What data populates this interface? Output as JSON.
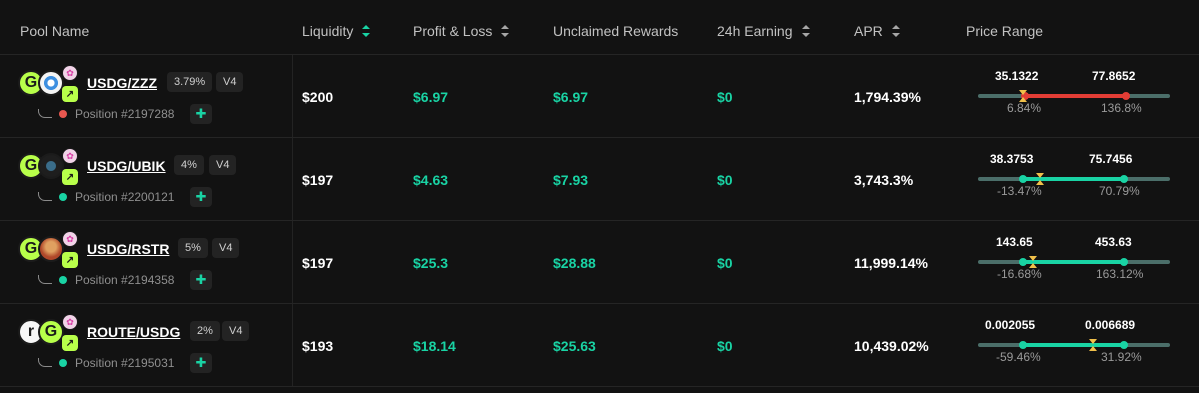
{
  "header": {
    "pool_name": "Pool Name",
    "liquidity": "Liquidity",
    "pnl": "Profit & Loss",
    "unclaimed": "Unclaimed Rewards",
    "earning": "24h Earning",
    "apr": "APR",
    "price_range": "Price Range"
  },
  "colors": {
    "accent": "#19d3a4",
    "out_of_range": "#e23d35",
    "current_marker": "#f0c04a",
    "token_green": "#b8ff4a"
  },
  "rows": [
    {
      "pair": "USDG/ZZZ",
      "fee": "3.79%",
      "version": "V4",
      "position": "Position #2197288",
      "status": "out-of-range",
      "liquidity": "$200",
      "pnl": "$6.97",
      "unclaimed": "$6.97",
      "earning": "$0",
      "apr": "1,794.39%",
      "range": {
        "low": "35.1322",
        "high": "77.8652",
        "low_pct": "6.84%",
        "high_pct": "136.8%"
      }
    },
    {
      "pair": "USDG/UBIK",
      "fee": "4%",
      "version": "V4",
      "position": "Position #2200121",
      "status": "in-range",
      "liquidity": "$197",
      "pnl": "$4.63",
      "unclaimed": "$7.93",
      "earning": "$0",
      "apr": "3,743.3%",
      "range": {
        "low": "38.3753",
        "high": "75.7456",
        "low_pct": "-13.47%",
        "high_pct": "70.79%"
      }
    },
    {
      "pair": "USDG/RSTR",
      "fee": "5%",
      "version": "V4",
      "position": "Position #2194358",
      "status": "in-range",
      "liquidity": "$197",
      "pnl": "$25.3",
      "unclaimed": "$28.88",
      "earning": "$0",
      "apr": "11,999.14%",
      "range": {
        "low": "143.65",
        "high": "453.63",
        "low_pct": "-16.68%",
        "high_pct": "163.12%"
      }
    },
    {
      "pair": "ROUTE/USDG",
      "fee": "2%",
      "version": "V4",
      "position": "Position #2195031",
      "status": "in-range",
      "liquidity": "$193",
      "pnl": "$18.14",
      "unclaimed": "$25.63",
      "earning": "$0",
      "apr": "10,439.02%",
      "range": {
        "low": "0.002055",
        "high": "0.006689",
        "low_pct": "-59.46%",
        "high_pct": "31.92%"
      }
    }
  ]
}
